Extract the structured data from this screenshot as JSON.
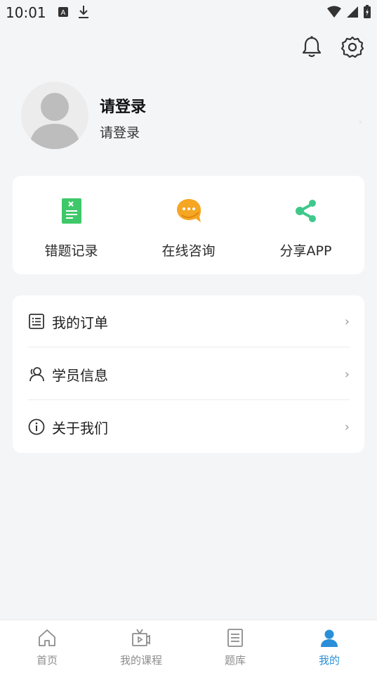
{
  "status_bar": {
    "time": "10:01"
  },
  "profile": {
    "name": "请登录",
    "subtitle": "请登录"
  },
  "quick_actions": [
    {
      "label": "错题记录",
      "icon": "wrong-questions-icon",
      "color": "#3fc86a"
    },
    {
      "label": "在线咨询",
      "icon": "chat-bubble-icon",
      "color": "#f5a623"
    },
    {
      "label": "分享APP",
      "icon": "share-icon",
      "color": "#3ec98a"
    }
  ],
  "menu": [
    {
      "label": "我的订单",
      "icon": "order-list-icon"
    },
    {
      "label": "学员信息",
      "icon": "user-info-icon"
    },
    {
      "label": "关于我们",
      "icon": "info-icon"
    }
  ],
  "tabs": [
    {
      "label": "首页",
      "icon": "home-icon"
    },
    {
      "label": "我的课程",
      "icon": "video-course-icon"
    },
    {
      "label": "题库",
      "icon": "question-bank-icon"
    },
    {
      "label": "我的",
      "icon": "person-icon",
      "active": true
    }
  ],
  "colors": {
    "accent": "#2a8fd8",
    "background": "#f4f5f7"
  }
}
